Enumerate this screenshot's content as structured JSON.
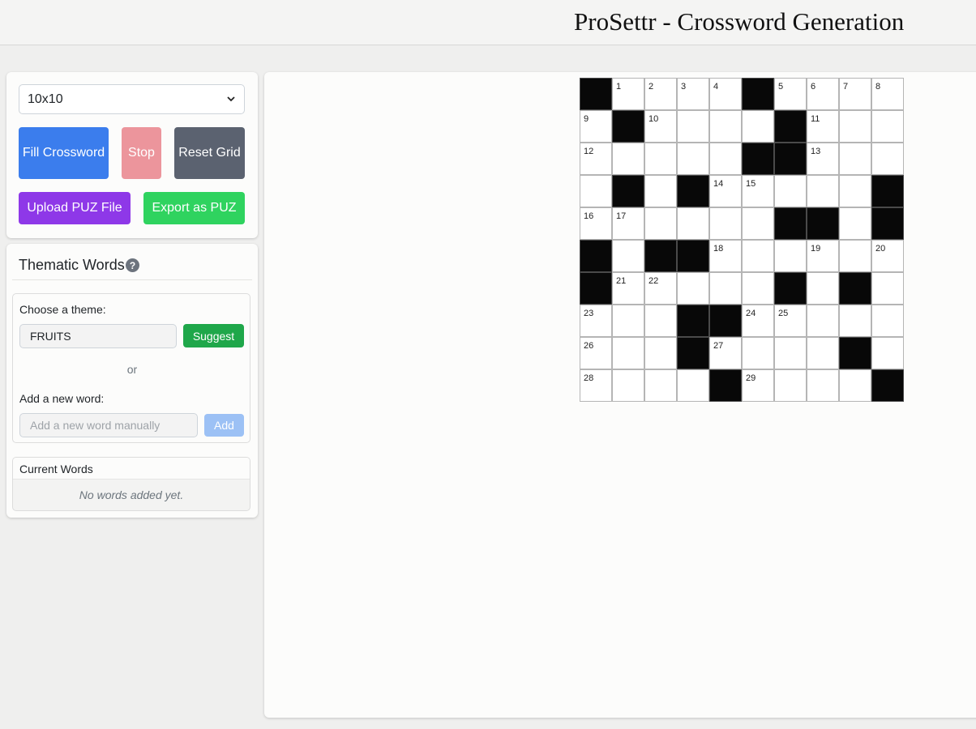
{
  "app": {
    "title": "ProSettr - Crossword Generation"
  },
  "controls": {
    "grid_size": "10x10",
    "fill_label": "Fill Crossword",
    "stop_label": "Stop",
    "reset_label": "Reset Grid",
    "upload_label": "Upload PUZ File",
    "export_label": "Export as PUZ"
  },
  "thematic": {
    "title": "Thematic Words",
    "help_icon": "?",
    "theme_label": "Choose a theme:",
    "theme_value": "FRUITS",
    "suggest_label": "Suggest",
    "or_text": "or",
    "add_label": "Add a new word:",
    "word_placeholder": "Add a new word manually",
    "add_button": "Add",
    "current_words_title": "Current Words",
    "empty_message": "No words added yet."
  },
  "grid": {
    "rows": 10,
    "cols": 10,
    "cells": [
      [
        0,
        1,
        2,
        3,
        4,
        0,
        5,
        6,
        7,
        8
      ],
      [
        9,
        0,
        10,
        "",
        "",
        "",
        0,
        11,
        "",
        ""
      ],
      [
        12,
        "",
        "",
        "",
        "",
        0,
        0,
        13,
        "",
        ""
      ],
      [
        "",
        0,
        "",
        0,
        14,
        15,
        "",
        "",
        "",
        0
      ],
      [
        16,
        17,
        "",
        "",
        "",
        "",
        0,
        0,
        "",
        0
      ],
      [
        0,
        "",
        0,
        0,
        18,
        "",
        "",
        19,
        "",
        20
      ],
      [
        0,
        21,
        22,
        "",
        "",
        "",
        0,
        "",
        0,
        ""
      ],
      [
        23,
        "",
        "",
        0,
        0,
        24,
        25,
        "",
        "",
        ""
      ],
      [
        26,
        "",
        "",
        0,
        27,
        "",
        "",
        "",
        0,
        ""
      ],
      [
        28,
        "",
        "",
        "",
        0,
        29,
        "",
        "",
        "",
        0
      ]
    ]
  },
  "colors": {
    "primary": "#3b7ded",
    "danger_disabled": "#ec959c",
    "secondary": "#5b6270",
    "purple": "#8e38e8",
    "green": "#2fd35f",
    "success": "#1fa74a",
    "black_cell": "#080808"
  }
}
